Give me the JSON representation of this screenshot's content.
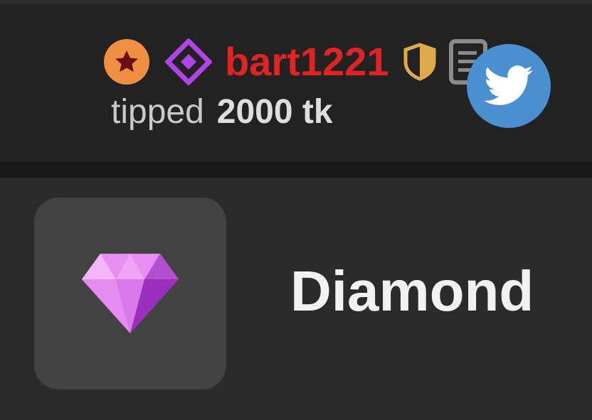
{
  "tip_notice": {
    "username": "bart1221",
    "tip_prefix": "tipped",
    "tip_amount": "2000 tk",
    "badges": [
      "star-badge-icon",
      "diamond-badge-icon",
      "shield-icon",
      "document-icon"
    ],
    "twitter_icon": "twitter-icon"
  },
  "gift": {
    "icon": "diamond-gem-icon",
    "name": "Diamond"
  },
  "colors": {
    "username": "#e02424",
    "star_badge": "#ef8f42",
    "diamond_badge": "#b044e6",
    "shield": "#e0a94a",
    "twitter": "#4a8fcf"
  }
}
